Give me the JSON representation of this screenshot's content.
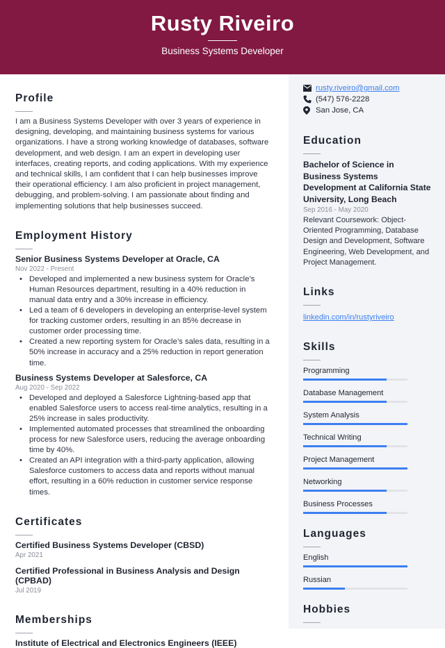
{
  "header": {
    "name": "Rusty Riveiro",
    "title": "Business Systems Developer"
  },
  "colors": {
    "header_bg": "#821942",
    "accent": "#3b7ff0",
    "sidebar_bg": "#f3f4f7"
  },
  "profile": {
    "heading": "Profile",
    "text": "I am a Business Systems Developer with over 3 years of experience in designing, developing, and maintaining business systems for various organizations. I have a strong working knowledge of databases, software development, and web design. I am an expert in developing user interfaces, creating reports, and coding applications. With my experience and technical skills, I am confident that I can help businesses improve their operational efficiency. I am also proficient in project management, debugging, and problem-solving. I am passionate about finding and implementing solutions that help businesses succeed."
  },
  "employment": {
    "heading": "Employment History",
    "jobs": [
      {
        "title": "Senior Business Systems Developer at Oracle, CA",
        "date": "Nov 2022 - Present",
        "bullets": [
          "Developed and implemented a new business system for Oracle’s Human Resources department, resulting in a 40% reduction in manual data entry and a 30% increase in efficiency.",
          "Led a team of 6 developers in developing an enterprise-level system for tracking customer orders, resulting in an 85% decrease in customer order processing time.",
          "Created a new reporting system for Oracle’s sales data, resulting in a 50% increase in accuracy and a 25% reduction in report generation time."
        ]
      },
      {
        "title": "Business Systems Developer at Salesforce, CA",
        "date": "Aug 2020 - Sep 2022",
        "bullets": [
          "Developed and deployed a Salesforce Lightning-based app that enabled Salesforce users to access real-time analytics, resulting in a 25% increase in sales productivity.",
          "Implemented automated processes that streamlined the onboarding process for new Salesforce users, reducing the average onboarding time by 40%.",
          "Created an API integration with a third-party application, allowing Salesforce customers to access data and reports without manual effort, resulting in a 60% reduction in customer service response times."
        ]
      }
    ]
  },
  "certificates": {
    "heading": "Certificates",
    "items": [
      {
        "name": "Certified Business Systems Developer (CBSD)",
        "date": "Apr 2021"
      },
      {
        "name": "Certified Professional in Business Analysis and Design (CPBAD)",
        "date": "Jul 2019"
      }
    ]
  },
  "memberships": {
    "heading": "Memberships",
    "items": [
      "Institute of Electrical and Electronics Engineers (IEEE)"
    ]
  },
  "contact": {
    "email": "rusty.riveiro@gmail.com",
    "phone": "(547) 576-2228",
    "location": "San Jose, CA"
  },
  "education": {
    "heading": "Education",
    "degree": "Bachelor of Science in Business Systems Development at California State University, Long Beach",
    "date": "Sep 2016 - May 2020",
    "description": "Relevant Coursework: Object-Oriented Programming, Database Design and Development, Software Engineering, Web Development, and Project Management."
  },
  "links": {
    "heading": "Links",
    "items": [
      "linkedin.com/in/rustyriveiro"
    ]
  },
  "skills": {
    "heading": "Skills",
    "items": [
      {
        "name": "Programming",
        "level": 0.8
      },
      {
        "name": "Database Management",
        "level": 0.8
      },
      {
        "name": "System Analysis",
        "level": 1.0
      },
      {
        "name": "Technical Writing",
        "level": 0.8
      },
      {
        "name": "Project Management",
        "level": 1.0
      },
      {
        "name": "Networking",
        "level": 0.8
      },
      {
        "name": "Business Processes",
        "level": 0.8
      }
    ]
  },
  "languages": {
    "heading": "Languages",
    "items": [
      {
        "name": "English",
        "level": 1.0
      },
      {
        "name": "Russian",
        "level": 0.4
      }
    ]
  },
  "hobbies": {
    "heading": "Hobbies"
  }
}
